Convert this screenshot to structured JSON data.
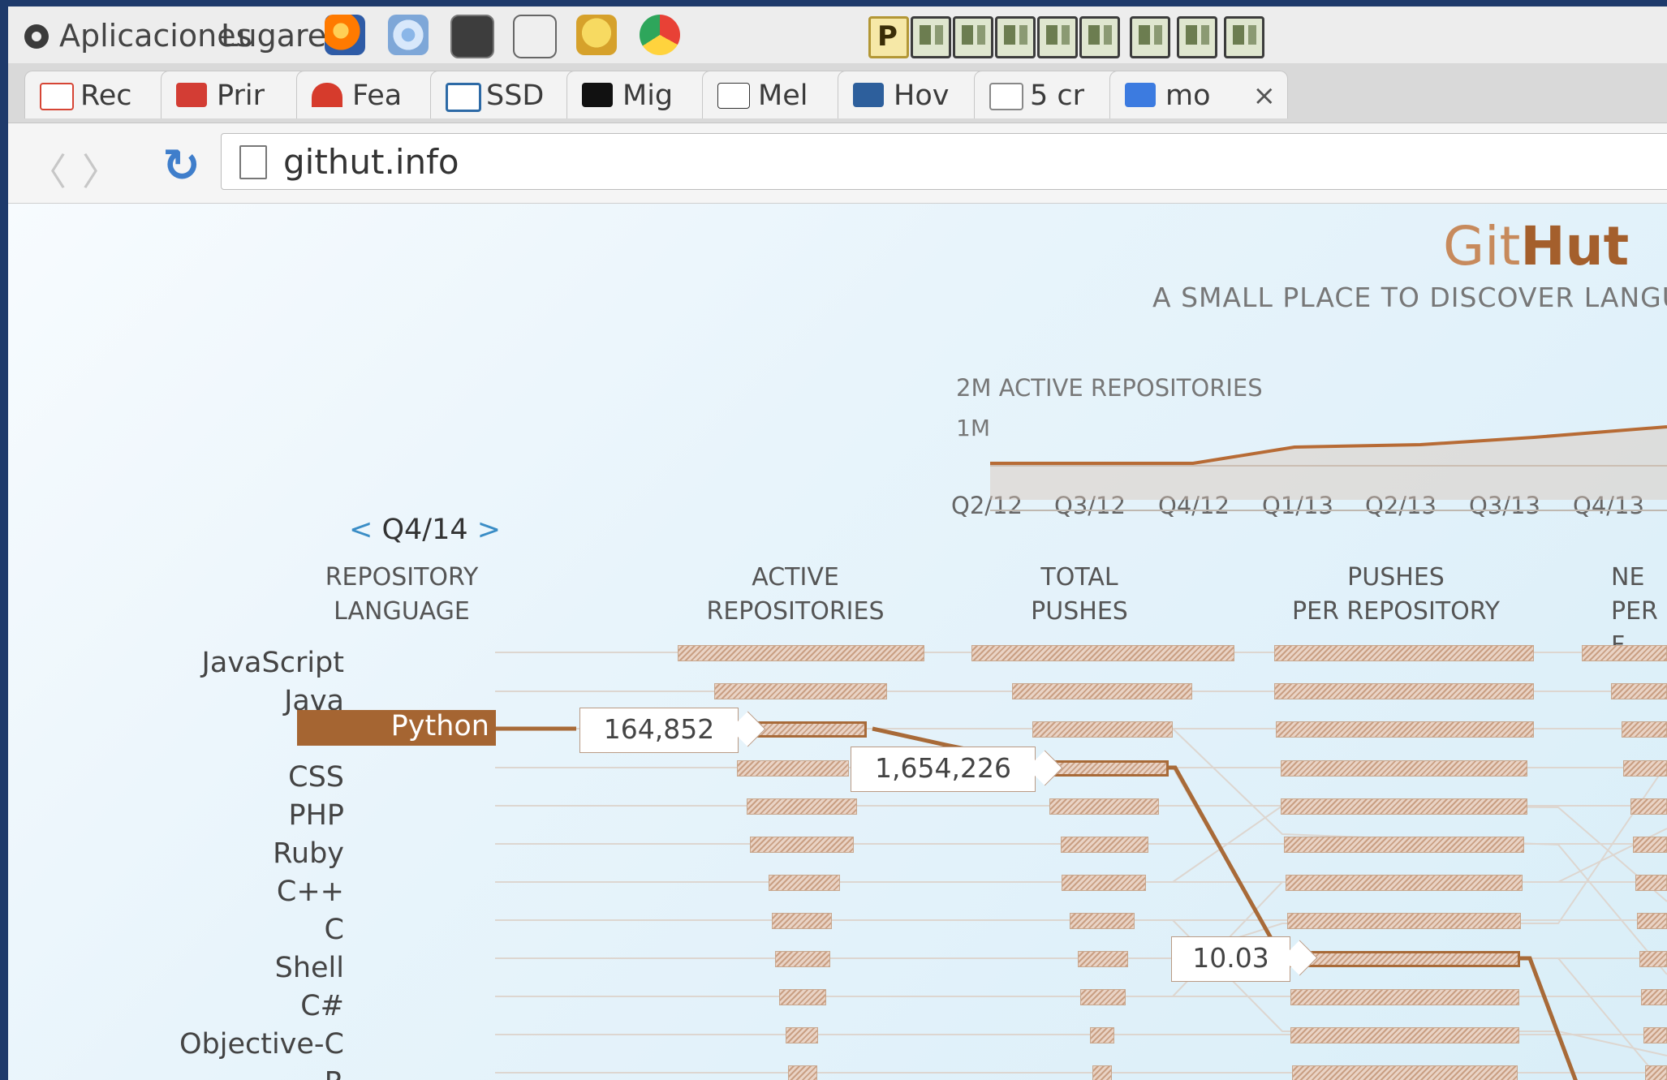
{
  "desktop": {
    "menu": [
      "Aplicaciones",
      "Lugares"
    ],
    "launchers": [
      "firefox-icon",
      "chromium-icon",
      "terminal-icon",
      "screenshot-tool-icon",
      "teapot-icon",
      "chrome-icon"
    ],
    "tray": [
      "P",
      "",
      "",
      "",
      "",
      "",
      "",
      "",
      ""
    ]
  },
  "browser": {
    "tabs": [
      {
        "label": "Rec",
        "icon": "gmail-icon",
        "color": "#d64535"
      },
      {
        "label": "Prir",
        "icon": "print-icon",
        "color": "#d33d34"
      },
      {
        "label": "Fea",
        "icon": "feature-icon",
        "color": "#d63b2c"
      },
      {
        "label": "SSD",
        "icon": "window-icon",
        "color": "#2d6aa6"
      },
      {
        "label": "Mig",
        "icon": "terminal-tab-icon",
        "color": "#111111"
      },
      {
        "label": "Mel",
        "icon": "wikipedia-icon",
        "color": "#222222"
      },
      {
        "label": "Hov",
        "icon": "monitor-icon",
        "color": "#2d5f9c"
      },
      {
        "label": "5 cr",
        "icon": "document-icon",
        "color": "#888888"
      },
      {
        "label": "mo",
        "icon": "google-icon",
        "color": "#3c7be0"
      }
    ],
    "url": "githut.info"
  },
  "page": {
    "brand_prefix": "Git",
    "brand_suffix": "Hut",
    "tagline": "A SMALL PLACE TO DISCOVER LANGU",
    "mini_chart": {
      "title": "2M ACTIVE REPOSITORIES",
      "y_label": "1M",
      "ticks": [
        "Q2/12",
        "Q3/12",
        "Q4/12",
        "Q1/13",
        "Q2/13",
        "Q3/13",
        "Q4/13"
      ]
    },
    "period": {
      "prev": "<",
      "label": "Q4/14",
      "next": ">"
    },
    "headers": {
      "language": [
        "REPOSITORY",
        "LANGUAGE"
      ],
      "active": [
        "ACTIVE",
        "REPOSITORIES"
      ],
      "pushes": [
        "TOTAL",
        "PUSHES"
      ],
      "ppr": [
        "PUSHES",
        "PER REPOSITORY"
      ],
      "next": [
        "NE",
        "PER F"
      ]
    },
    "languages": [
      "JavaScript",
      "Java",
      "Python",
      "CSS",
      "PHP",
      "Ruby",
      "C++",
      "C",
      "Shell",
      "C#",
      "Objective-C",
      "R"
    ],
    "selected": "Python",
    "callouts": {
      "active": "164,852",
      "pushes": "1,654,226",
      "ppr": "10.03"
    }
  },
  "colors": {
    "accent": "#a56532",
    "bar": "#c99f83",
    "highlight": "#a86a38"
  }
}
